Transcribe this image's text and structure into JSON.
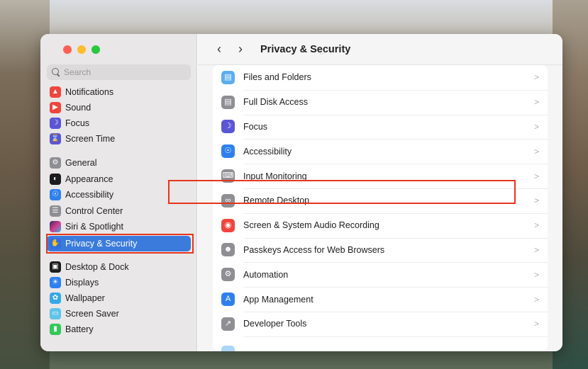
{
  "window": {
    "title": "Privacy & Security"
  },
  "toolbar": {
    "back_icon": "chevron-left-icon",
    "forward_icon": "chevron-right-icon",
    "title": "Privacy & Security"
  },
  "sidebar": {
    "search_placeholder": "Search",
    "items": [
      {
        "label": "Notifications",
        "icon": "bell-icon",
        "color": "#f0453c"
      },
      {
        "label": "Sound",
        "icon": "speaker-icon",
        "color": "#f0453c"
      },
      {
        "label": "Focus",
        "icon": "moon-icon",
        "color": "#5a56d6"
      },
      {
        "label": "Screen Time",
        "icon": "hourglass-icon",
        "color": "#5a56d6"
      },
      {
        "label": "General",
        "icon": "gear-icon",
        "color": "#8e8e93"
      },
      {
        "label": "Appearance",
        "icon": "appearance-icon",
        "color": "#1c1c1e"
      },
      {
        "label": "Accessibility",
        "icon": "accessibility-icon",
        "color": "#2f80ed"
      },
      {
        "label": "Control Center",
        "icon": "control-center-icon",
        "color": "#8e8e93"
      },
      {
        "label": "Siri & Spotlight",
        "icon": "siri-icon",
        "color": "#4a3aa8"
      },
      {
        "label": "Privacy & Security",
        "icon": "hand-icon",
        "color": "#2f6fe0",
        "selected": true
      },
      {
        "label": "Desktop & Dock",
        "icon": "dock-icon",
        "color": "#1c1c1e"
      },
      {
        "label": "Displays",
        "icon": "sun-icon",
        "color": "#2f80ed"
      },
      {
        "label": "Wallpaper",
        "icon": "flower-icon",
        "color": "#35a9e8"
      },
      {
        "label": "Screen Saver",
        "icon": "screensaver-icon",
        "color": "#5fc4e8"
      },
      {
        "label": "Battery",
        "icon": "battery-icon",
        "color": "#34c759"
      }
    ]
  },
  "main": {
    "rows": [
      {
        "label": "Files and Folders",
        "icon": "folder-icon",
        "color": "#5aaef0"
      },
      {
        "label": "Full Disk Access",
        "icon": "disk-icon",
        "color": "#8e8e93"
      },
      {
        "label": "Focus",
        "icon": "moon-icon",
        "color": "#5a56d6"
      },
      {
        "label": "Accessibility",
        "icon": "accessibility-icon",
        "color": "#2f80ed"
      },
      {
        "label": "Input Monitoring",
        "icon": "keyboard-icon",
        "color": "#8e8e93"
      },
      {
        "label": "Remote Desktop",
        "icon": "binoculars-icon",
        "color": "#8e8e93"
      },
      {
        "label": "Screen & System Audio Recording",
        "icon": "record-icon",
        "color": "#f0453c"
      },
      {
        "label": "Passkeys Access for Web Browsers",
        "icon": "passkey-icon",
        "color": "#8e8e93"
      },
      {
        "label": "Automation",
        "icon": "automation-icon",
        "color": "#8e8e93"
      },
      {
        "label": "App Management",
        "icon": "app-store-icon",
        "color": "#2f80ed"
      },
      {
        "label": "Developer Tools",
        "icon": "developer-tools-icon",
        "color": "#8e8e93"
      }
    ]
  }
}
